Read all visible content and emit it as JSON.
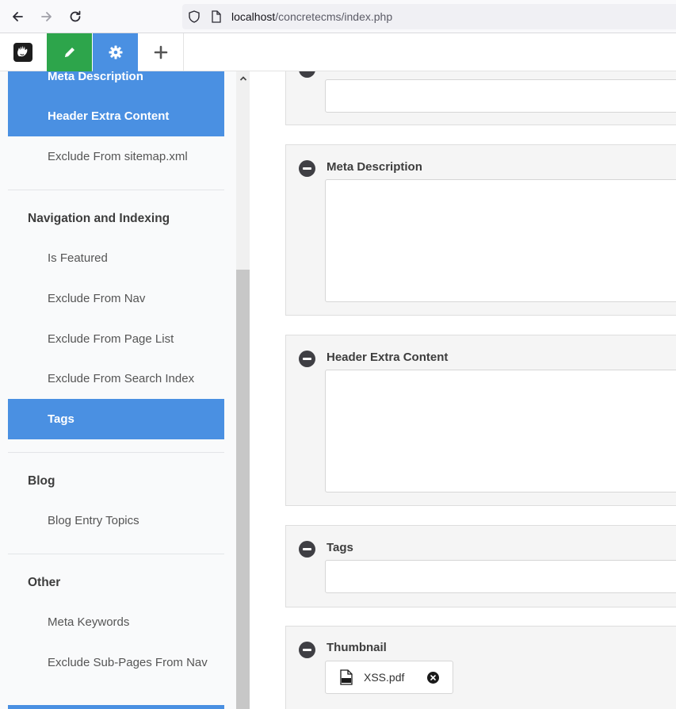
{
  "browser": {
    "url_host": "localhost",
    "url_path": "/concretecms/index.php"
  },
  "toolbar": {
    "logo_icon": "concrete-logo-icon",
    "edit_icon": "pencil-icon",
    "settings_icon": "gear-icon",
    "add_icon": "plus-icon",
    "edit_color": "#2da54b",
    "settings_color": "#4a90e2"
  },
  "sidebar": {
    "items": [
      {
        "label": "Meta Description"
      },
      {
        "label": "Header Extra Content"
      },
      {
        "label": "Exclude From sitemap.xml"
      },
      {
        "label": "Is Featured"
      },
      {
        "label": "Exclude From Nav"
      },
      {
        "label": "Exclude From Page List"
      },
      {
        "label": "Exclude From Search Index"
      },
      {
        "label": "Tags"
      },
      {
        "label": "Blog Entry Topics"
      },
      {
        "label": "Meta Keywords"
      },
      {
        "label": "Exclude Sub-Pages From Nav"
      }
    ],
    "headings": [
      {
        "label": "Navigation and Indexing"
      },
      {
        "label": "Blog"
      },
      {
        "label": "Other"
      }
    ],
    "active_color": "#4a90e2"
  },
  "main": {
    "panels": [
      {
        "title": ""
      },
      {
        "title": "Meta Description"
      },
      {
        "title": "Header Extra Content"
      },
      {
        "title": "Tags"
      },
      {
        "title": "Thumbnail"
      }
    ],
    "thumbnail_file": "XSS.pdf"
  }
}
